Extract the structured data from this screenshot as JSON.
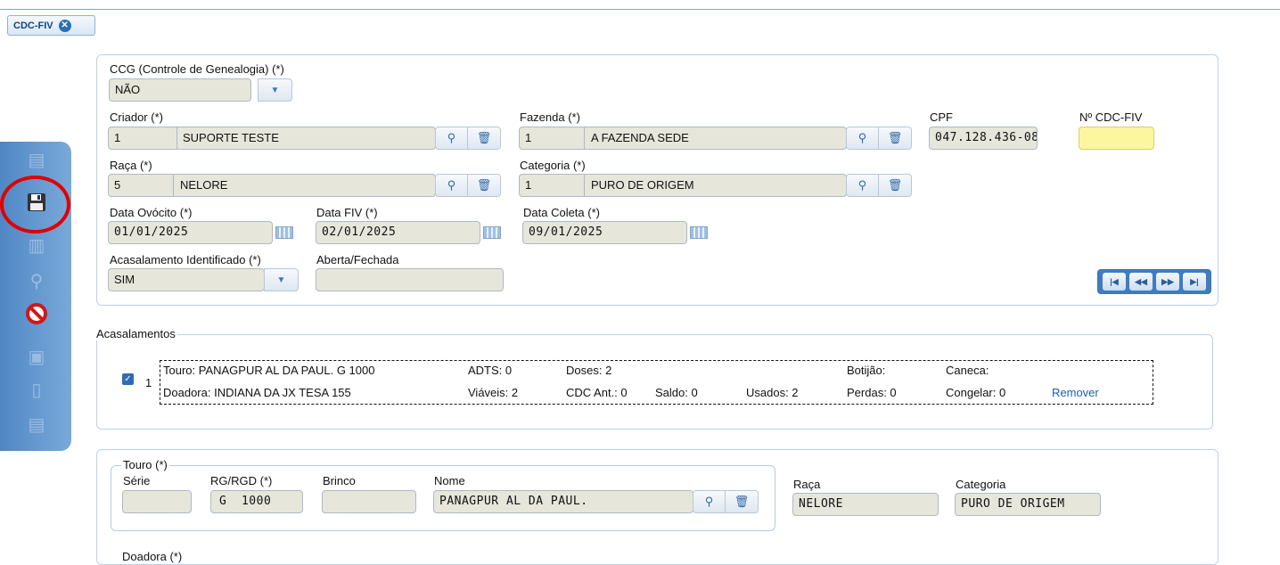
{
  "tab": {
    "title": "CDC-FIV",
    "close_icon": "close-circle-icon"
  },
  "form": {
    "ccg": {
      "label": "CCG (Controle de Genealogia) (*)",
      "value": "NÃO"
    },
    "criador": {
      "label": "Criador (*)",
      "code": "1",
      "name": "SUPORTE TESTE"
    },
    "fazenda": {
      "label": "Fazenda (*)",
      "code": "1",
      "name": "A FAZENDA SEDE"
    },
    "cpf": {
      "label": "CPF",
      "value": "047.128.436-08"
    },
    "numero": {
      "label": "Nº CDC-FIV",
      "value": ""
    },
    "raca": {
      "label": "Raça (*)",
      "code": "5",
      "name": "NELORE"
    },
    "categoria": {
      "label": "Categoria (*)",
      "code": "1",
      "name": "PURO DE ORIGEM"
    },
    "data_ovocito": {
      "label": "Data Ovócito (*)",
      "value": "01/01/2025"
    },
    "data_fiv": {
      "label": "Data FIV (*)",
      "value": "02/01/2025"
    },
    "data_coleta": {
      "label": "Data Coleta (*)",
      "value": "09/01/2025"
    },
    "acasalamento_identificado": {
      "label": "Acasalamento Identificado (*)",
      "value": "SIM"
    },
    "aberta_fechada": {
      "label": "Aberta/Fechada",
      "value": ""
    }
  },
  "acasalamentos": {
    "title": "Acasalamentos",
    "rows": [
      {
        "index": "1",
        "touro": "Touro: PANAGPUR AL DA PAUL. G 1000",
        "adts": "ADTS: 0",
        "doses": "Doses: 2",
        "botijao": "Botijão:",
        "caneca": "Caneca:",
        "doadora": "Doadora: INDIANA DA JX TESA 155",
        "viaveis": "Viáveis: 2",
        "cdc_ant": "CDC Ant.: 0",
        "saldo": "Saldo: 0",
        "usados": "Usados: 2",
        "perdas": "Perdas: 0",
        "congelar": "Congelar: 0",
        "remover": "Remover"
      }
    ]
  },
  "touro": {
    "title": "Touro (*)",
    "serie_label": "Série",
    "serie": "",
    "rg_label": "RG/RGD (*)",
    "rg": "G  1000",
    "brinco_label": "Brinco",
    "brinco": "",
    "nome_label": "Nome",
    "nome": "PANAGPUR AL DA PAUL.",
    "raca_label": "Raça",
    "raca": "NELORE",
    "categoria_label": "Categoria",
    "categoria": "PURO DE ORIGEM"
  },
  "doadora_partial": {
    "title": "Doadora (*)"
  },
  "icons": {
    "sidebar": [
      "new-document-icon",
      "save-icon",
      "delete-icon",
      "search-icon",
      "cancel-icon",
      "pdf-icon",
      "print-icon",
      "export-icon"
    ],
    "nav": [
      "first-record-icon",
      "previous-record-icon",
      "next-record-icon",
      "last-record-icon"
    ]
  }
}
